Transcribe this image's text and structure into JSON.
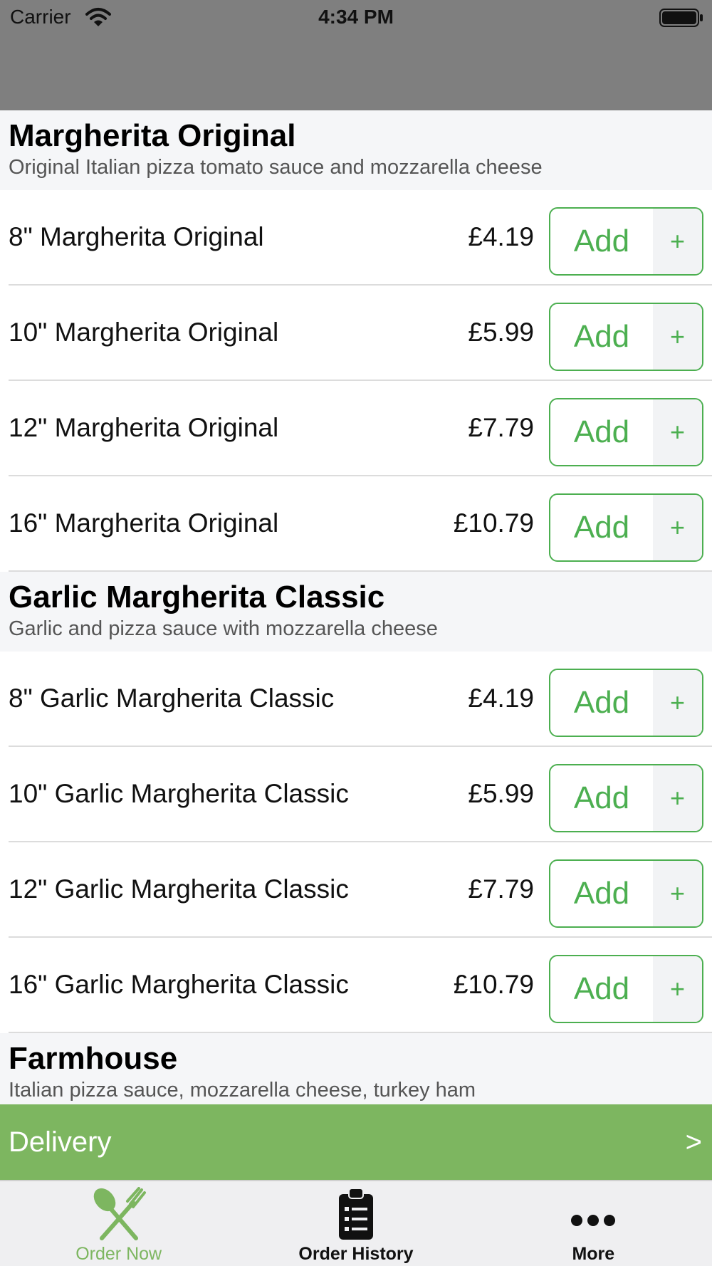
{
  "status_bar": {
    "carrier": "Carrier",
    "time": "4:34 PM"
  },
  "sections": [
    {
      "title": "Margherita Original",
      "description": "Original Italian pizza tomato sauce and mozzarella cheese",
      "items": [
        {
          "name": "8\" Margherita Original",
          "price": "£4.19",
          "add_label": "Add",
          "plus_label": "+"
        },
        {
          "name": "10\" Margherita Original",
          "price": "£5.99",
          "add_label": "Add",
          "plus_label": "+"
        },
        {
          "name": "12\" Margherita Original",
          "price": "£7.79",
          "add_label": "Add",
          "plus_label": "+"
        },
        {
          "name": "16\" Margherita Original",
          "price": "£10.79",
          "add_label": "Add",
          "plus_label": "+"
        }
      ]
    },
    {
      "title": "Garlic Margherita Classic",
      "description": "Garlic and pizza sauce with mozzarella cheese",
      "items": [
        {
          "name": "8\" Garlic Margherita Classic",
          "price": "£4.19",
          "add_label": "Add",
          "plus_label": "+"
        },
        {
          "name": "10\" Garlic Margherita Classic",
          "price": "£5.99",
          "add_label": "Add",
          "plus_label": "+"
        },
        {
          "name": "12\" Garlic Margherita Classic",
          "price": "£7.79",
          "add_label": "Add",
          "plus_label": "+"
        },
        {
          "name": "16\" Garlic Margherita Classic",
          "price": "£10.79",
          "add_label": "Add",
          "plus_label": "+"
        }
      ]
    },
    {
      "title": "Farmhouse",
      "description": "Italian pizza sauce, mozzarella cheese, turkey ham",
      "items": []
    }
  ],
  "delivery_bar": {
    "label": "Delivery",
    "arrow": ">"
  },
  "tab_bar": {
    "tabs": [
      {
        "label": "Order Now",
        "icon": "fork-knife-icon",
        "active": true
      },
      {
        "label": "Order History",
        "icon": "clipboard-list-icon",
        "active": false
      },
      {
        "label": "More",
        "icon": "more-dots-icon",
        "active": false
      }
    ]
  },
  "colors": {
    "accent_green": "#4caf50",
    "delivery_green": "#7db660",
    "nav_gray": "#7f7f7f"
  }
}
